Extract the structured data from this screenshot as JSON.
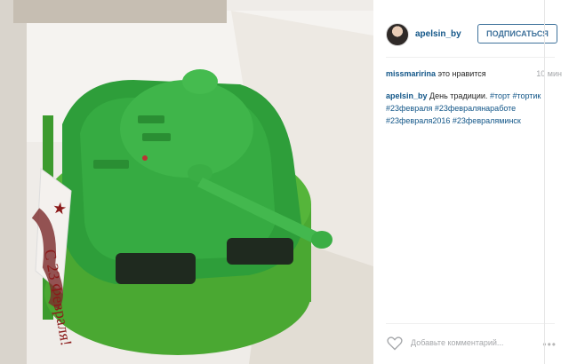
{
  "post": {
    "username": "apelsin_by",
    "follow_label": "ПОДПИСАТЬСЯ"
  },
  "likes": {
    "liker": "missmaririna",
    "text": "это нравится",
    "time": "10 мин"
  },
  "caption": {
    "author": "apelsin_by",
    "text": "День традиции.",
    "tags": [
      "#торт",
      "#тортик",
      "#23февраля",
      "#23февралянаработе",
      "#23февраля2016",
      "#23февраляминск"
    ]
  },
  "ribbon_text": "С 23 Февраля!",
  "comment": {
    "placeholder": "Добавьте комментарий..."
  },
  "more_label": "•••",
  "colors": {
    "link": "#125688",
    "follow": "#3f729b",
    "tank_green": "#2e9e3a"
  }
}
